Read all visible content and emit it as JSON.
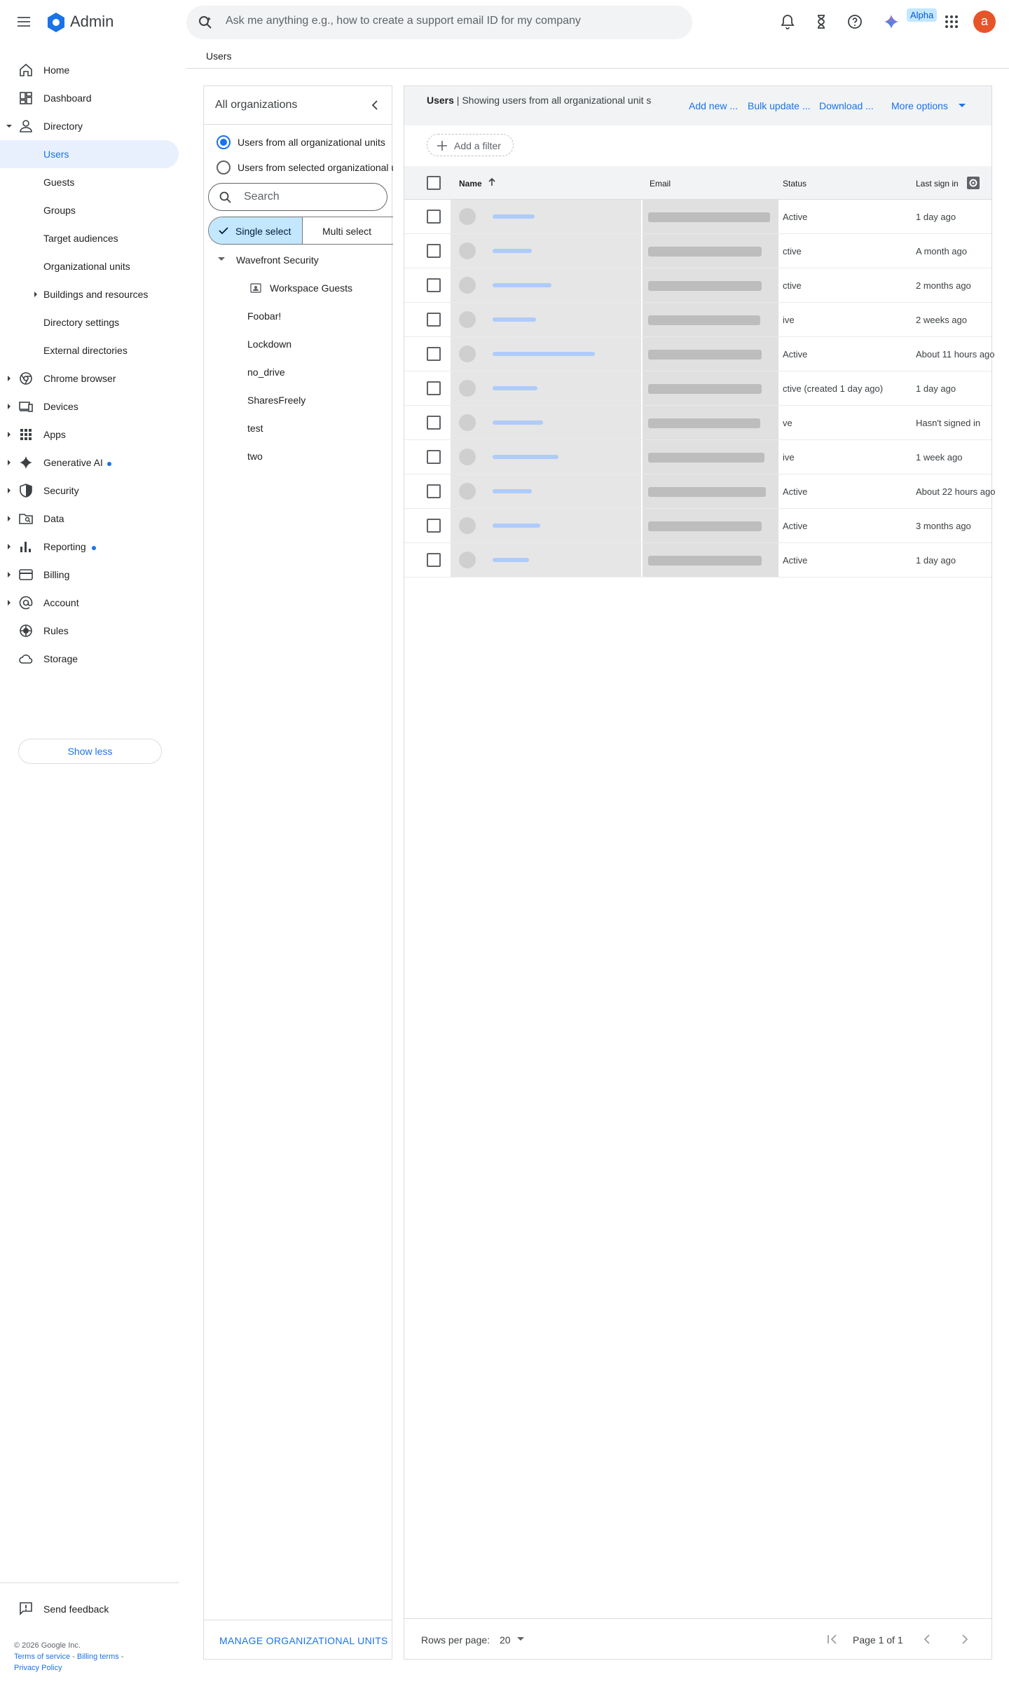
{
  "header": {
    "app_title": "Admin",
    "search_placeholder": "Ask me anything e.g., how to create a support email ID for my company",
    "alpha_badge": "Alpha",
    "avatar_letter": "a",
    "colors": {
      "accent": "#1a73e8",
      "avatar": "#e8542a",
      "selected_bg": "#e8f0fe"
    }
  },
  "breadcrumb": "Users",
  "sidebar": {
    "items": [
      {
        "label": "Home",
        "icon": "home-icon"
      },
      {
        "label": "Dashboard",
        "icon": "dashboard-icon"
      },
      {
        "label": "Directory",
        "icon": "person-icon",
        "expanded": true
      },
      {
        "label": "Users",
        "active": true
      },
      {
        "label": "Guests"
      },
      {
        "label": "Groups"
      },
      {
        "label": "Target audiences"
      },
      {
        "label": "Organizational units"
      },
      {
        "label": "Buildings and resources",
        "collapsed": true
      },
      {
        "label": "Directory settings"
      },
      {
        "label": "External directories"
      },
      {
        "label": "Chrome browser",
        "icon": "chrome-icon"
      },
      {
        "label": "Devices",
        "icon": "devices-icon"
      },
      {
        "label": "Apps",
        "icon": "apps-grid-icon"
      },
      {
        "label": "Generative AI",
        "icon": "sparkle-icon",
        "dot": true
      },
      {
        "label": "Security",
        "icon": "shield-icon"
      },
      {
        "label": "Data",
        "icon": "data-folder-icon"
      },
      {
        "label": "Reporting",
        "icon": "bar-chart-icon",
        "dot": true
      },
      {
        "label": "Billing",
        "icon": "credit-card-icon"
      },
      {
        "label": "Account",
        "icon": "at-sign-icon"
      },
      {
        "label": "Rules",
        "icon": "rules-icon"
      },
      {
        "label": "Storage",
        "icon": "cloud-icon"
      }
    ],
    "show_less": "Show less",
    "send_feedback": "Send feedback",
    "copyright": "© 2026 Google Inc.",
    "terms": "Terms of service",
    "billing_terms": "Billing terms",
    "privacy": "Privacy Policy"
  },
  "org_panel": {
    "title": "All organizations",
    "radio_all": "Users from all organizational units",
    "radio_selected": "Users from selected organizational units",
    "search_placeholder": "Search",
    "single_select": "Single select",
    "multi_select": "Multi select",
    "root": "Wavefront Security",
    "children": [
      "Workspace Guests",
      "Foobar!",
      "Lockdown",
      "no_drive",
      "SharesFreely",
      "test",
      "two"
    ],
    "manage": "MANAGE ORGANIZATIONAL UNITS"
  },
  "users_panel": {
    "title_bold": "Users",
    "title_rest": " | Showing users from all organizational unit s",
    "actions": {
      "add_new": "Add new ...",
      "bulk_update": "Bulk update ...",
      "download": "Download ...",
      "more": "More options"
    },
    "add_filter": "Add a filter",
    "columns": {
      "name": "Name",
      "email": "Email",
      "status": "Status",
      "last_sign_in": "Last sign in"
    },
    "rows": [
      {
        "status": "Active",
        "last_sign_in": "1 day ago"
      },
      {
        "status": "ctive",
        "last_sign_in": "A month ago"
      },
      {
        "status": "ctive",
        "last_sign_in": "2 months ago"
      },
      {
        "status": "ive",
        "last_sign_in": "2 weeks ago"
      },
      {
        "status": "Active",
        "last_sign_in": "About 11 hours ago"
      },
      {
        "status": "ctive (created 1 day ago)",
        "last_sign_in": "1 day ago"
      },
      {
        "status": "ve",
        "last_sign_in": "Hasn't signed in"
      },
      {
        "status": "ive",
        "last_sign_in": "1 week ago"
      },
      {
        "status": "Active",
        "last_sign_in": "About 22 hours ago"
      },
      {
        "status": "Active",
        "last_sign_in": "3 months ago"
      },
      {
        "status": "Active",
        "last_sign_in": "1 day ago"
      }
    ],
    "pager": {
      "rows_per_page_label": "Rows per page:",
      "rows_per_page": "20",
      "page_info": "Page 1 of 1"
    }
  }
}
